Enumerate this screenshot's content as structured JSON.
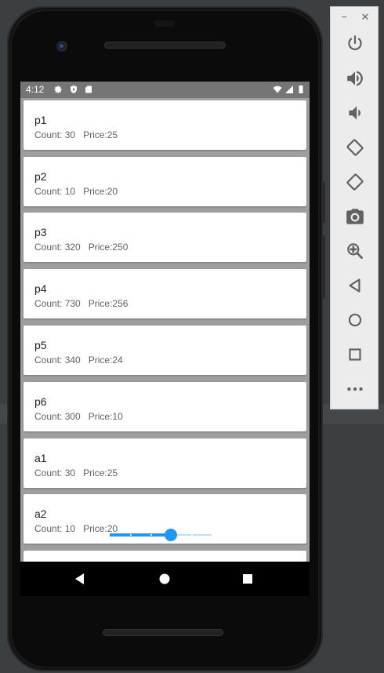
{
  "status_bar": {
    "time": "4:12"
  },
  "items": [
    {
      "name": "p1",
      "count_label": "Count: 30",
      "price_label": "Price:25"
    },
    {
      "name": "p2",
      "count_label": "Count: 10",
      "price_label": "Price:20"
    },
    {
      "name": "p3",
      "count_label": "Count: 320",
      "price_label": "Price:250"
    },
    {
      "name": "p4",
      "count_label": "Count: 730",
      "price_label": "Price:256"
    },
    {
      "name": "p5",
      "count_label": "Count: 340",
      "price_label": "Price:24"
    },
    {
      "name": "p6",
      "count_label": "Count: 300",
      "price_label": "Price:10"
    },
    {
      "name": "a1",
      "count_label": "Count: 30",
      "price_label": "Price:25"
    },
    {
      "name": "a2",
      "count_label": "Count: 10",
      "price_label": "Price:20"
    }
  ],
  "slider": {
    "fraction": 0.6,
    "accent": "#2196f3"
  },
  "toolbar": {
    "window_controls": [
      "minimize-icon",
      "close-icon"
    ],
    "buttons": [
      "power-icon",
      "volume-up-icon",
      "volume-down-icon",
      "rotate-left-icon",
      "rotate-right-icon",
      "camera-icon",
      "zoom-icon",
      "back-icon",
      "home-icon",
      "overview-icon",
      "more-icon"
    ]
  },
  "colors": {
    "status_bar": "#757575",
    "list_bg": "#9e9e9e",
    "card": "#ffffff",
    "toolbar": "#ececec"
  }
}
